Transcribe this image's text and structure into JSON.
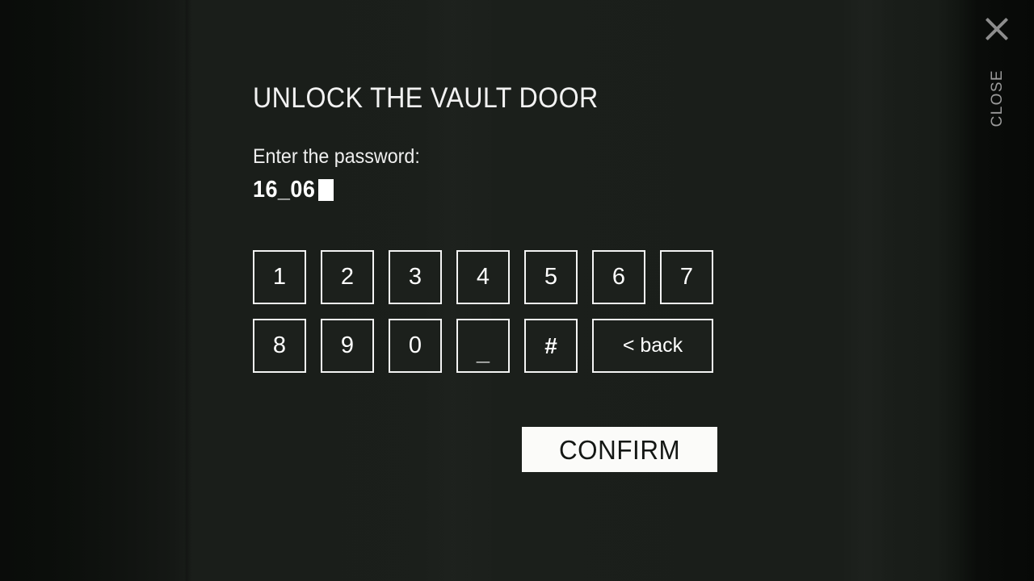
{
  "dialog": {
    "title": "UNLOCK THE VAULT DOOR",
    "prompt_label": "Enter the password:",
    "password_value": "16_06",
    "password_placeholder": "",
    "caret_visible": true
  },
  "keypad": {
    "rows": [
      [
        {
          "label": "1",
          "name": "key-1"
        },
        {
          "label": "2",
          "name": "key-2"
        },
        {
          "label": "3",
          "name": "key-3"
        },
        {
          "label": "4",
          "name": "key-4"
        },
        {
          "label": "5",
          "name": "key-5"
        },
        {
          "label": "6",
          "name": "key-6"
        },
        {
          "label": "7",
          "name": "key-7"
        }
      ],
      [
        {
          "label": "8",
          "name": "key-8"
        },
        {
          "label": "9",
          "name": "key-9"
        },
        {
          "label": "0",
          "name": "key-0"
        },
        {
          "label": "_",
          "name": "key-underscore"
        },
        {
          "label": "#",
          "name": "key-hash"
        },
        {
          "label": "< back",
          "name": "key-back"
        }
      ]
    ]
  },
  "confirm": {
    "label": "CONFIRM"
  },
  "close": {
    "label": "CLOSE",
    "icon": "close-x-icon"
  },
  "colors": {
    "panel_background": "#1b1f1b",
    "edge_background": "#0a0c0a",
    "key_border": "#f4f4f4",
    "key_fill": "#1c201c",
    "text_primary": "#f2f2f2",
    "confirm_background": "#fbfbf9",
    "confirm_text": "#141714",
    "close_gray": "#8d8d8d"
  }
}
